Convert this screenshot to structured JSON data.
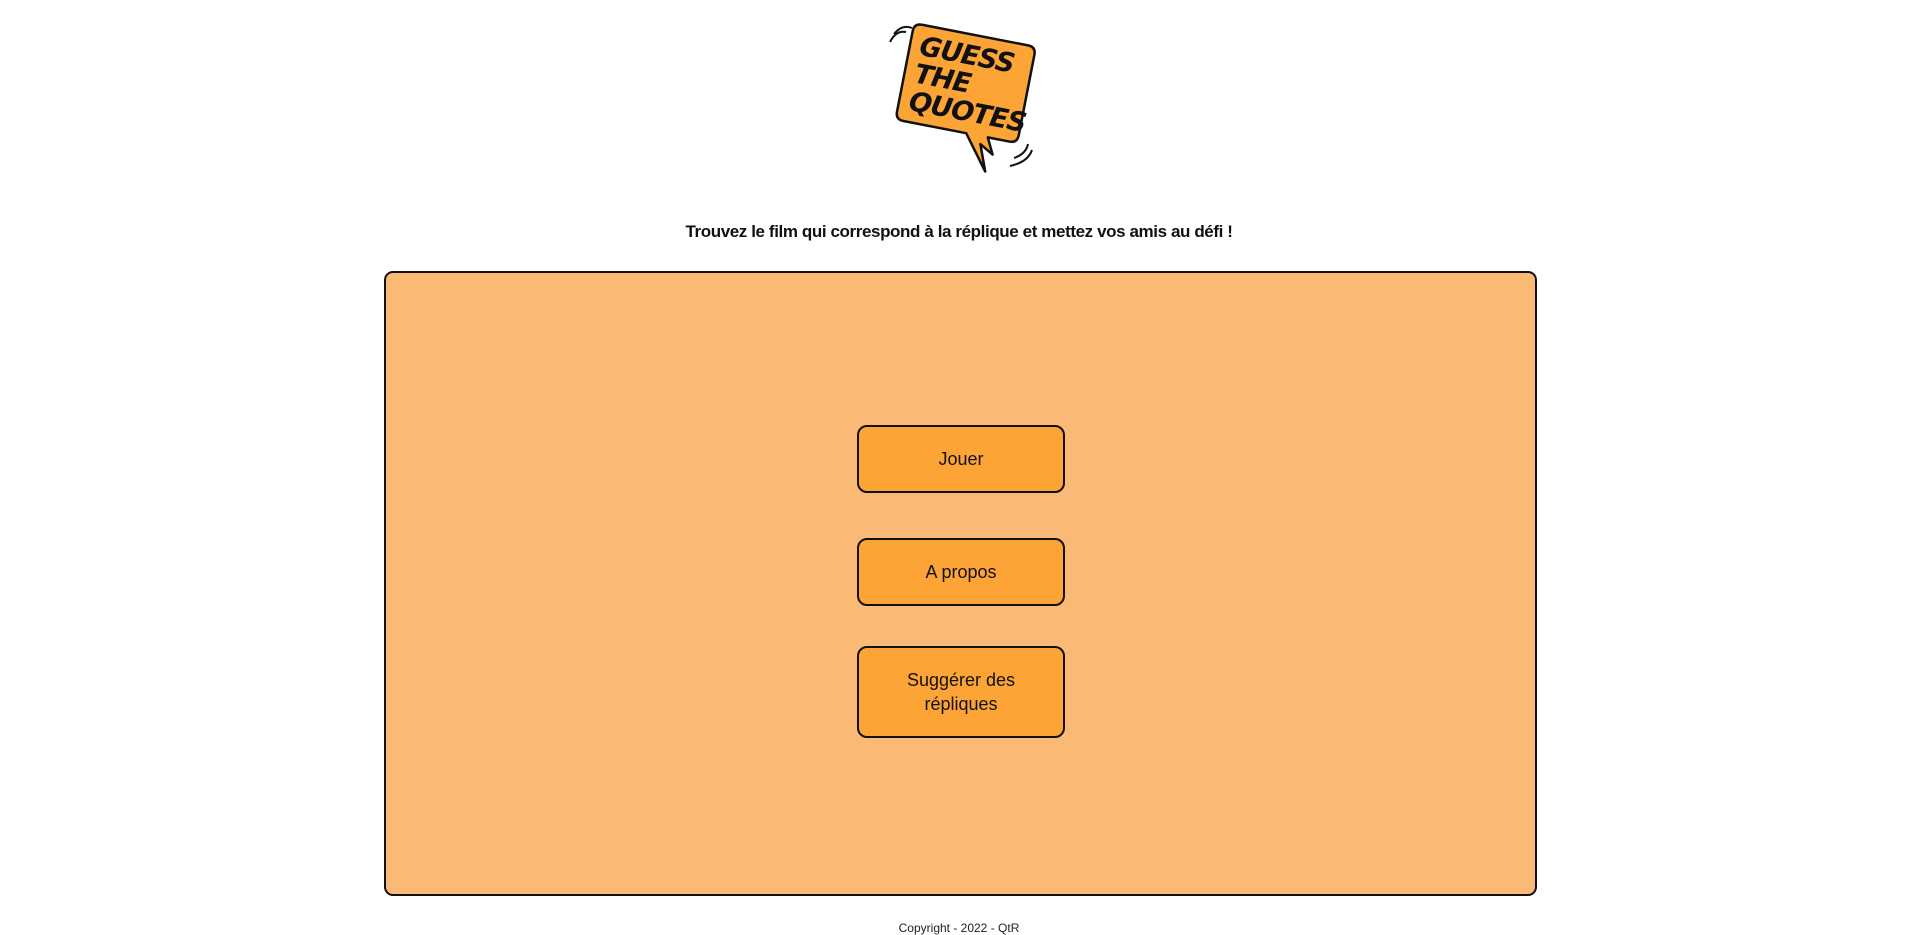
{
  "logo": {
    "lines": [
      "GUESS",
      "THE",
      "QUOTES"
    ],
    "colors": {
      "fill": "#fda437",
      "outline": "#111111"
    }
  },
  "tagline": "Trouvez le film qui correspond à la réplique et mettez vos amis au défi !",
  "menu": {
    "play_label": "Jouer",
    "about_label": "A propos",
    "suggest_label": "Suggérer des répliques"
  },
  "footer": {
    "copyright": "Copyright - 2022 - QtR"
  },
  "colors": {
    "panel_bg": "#fbb976",
    "button_bg": "#fda437",
    "border": "#111111"
  }
}
